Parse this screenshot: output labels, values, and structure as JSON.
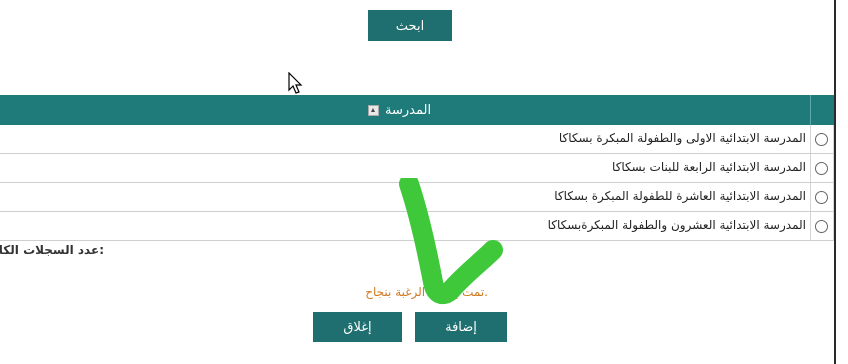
{
  "search": {
    "label": "ابحث"
  },
  "grid": {
    "header": "المدرسة",
    "rows": [
      "المدرسة الابتدائية الاولى والطفولة المبكرة بسكاكا",
      "المدرسة الابتدائية الرابعة للبنات بسكاكا",
      "المدرسة الابتدائية العاشرة للطفولة المبكرة بسكاكا",
      "المدرسة الابتدائية العشرون والطفولة المبكرةبسكاكا"
    ]
  },
  "total_records_label": "عدد السجلات الكلي:",
  "status": {
    "message": "تمت إضافة الرغبة بنجاح."
  },
  "actions": {
    "add_label": "إضافة",
    "close_label": "إغلاق"
  },
  "colors": {
    "primary": "#1f6e70",
    "header": "#1f7a7a",
    "annotation": "#3ec83a",
    "status": "#d07a20"
  }
}
